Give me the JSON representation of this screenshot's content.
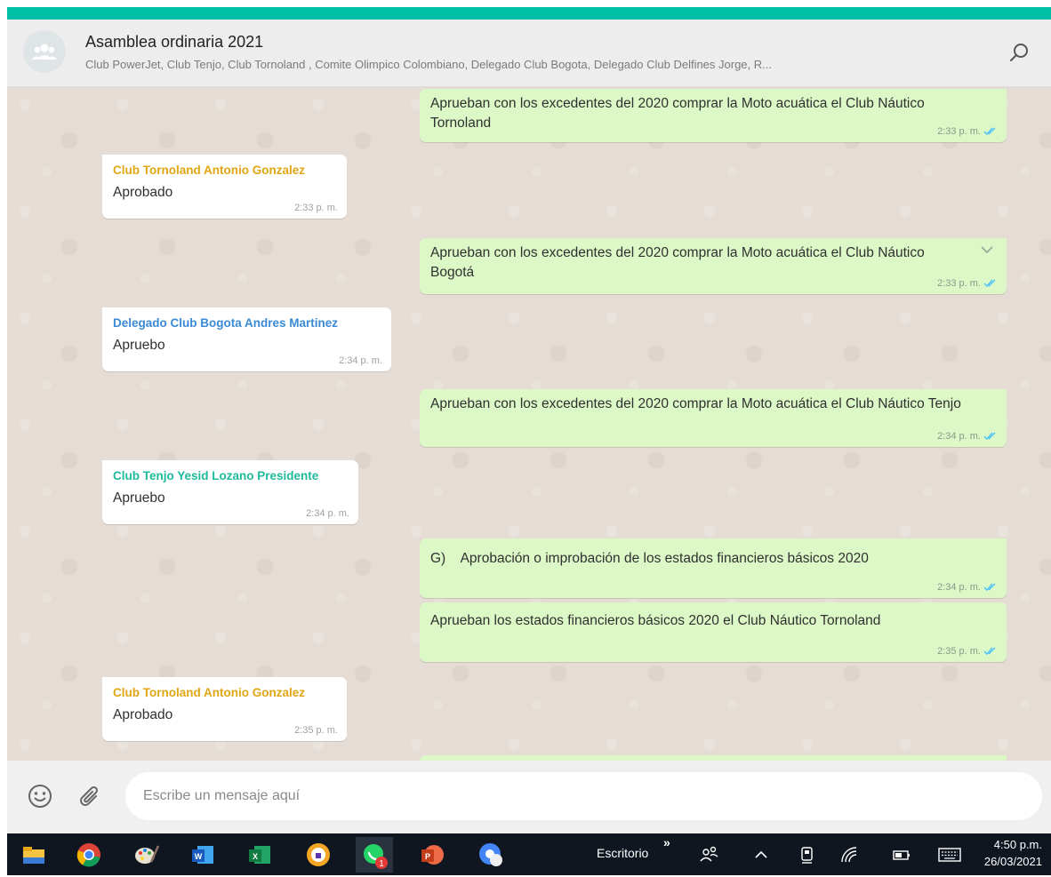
{
  "header": {
    "title": "Asamblea ordinaria 2021",
    "participants": "Club PowerJet, Club Tenjo, Club Tornoland , Comite Olimpico Colombiano, Delegado Club Bogota, Delegado Club Delfines Jorge, R..."
  },
  "messages": [
    {
      "type": "out",
      "text": "Aprueban con los excedentes del 2020 comprar la Moto acuática el Club Náutico Tornoland",
      "time": "2:33 p. m."
    },
    {
      "type": "in",
      "sender": "Club Tornoland Antonio Gonzalez",
      "text": "Aprobado",
      "time": "2:33 p. m."
    },
    {
      "type": "out",
      "text": "Aprueban con los excedentes del 2020 comprar la Moto acuática el Club Náutico Bogotá",
      "time": "2:33 p. m."
    },
    {
      "type": "in",
      "sender": "Delegado Club Bogota Andres Martinez",
      "text": "Apruebo",
      "time": "2:34 p. m."
    },
    {
      "type": "out",
      "text": "Aprueban con los excedentes del 2020 comprar la Moto acuática el Club Náutico Tenjo",
      "time": "2:34 p. m."
    },
    {
      "type": "in",
      "sender": "Club Tenjo Yesid Lozano Presidente",
      "text": "Apruebo",
      "time": "2:34 p. m."
    },
    {
      "type": "out",
      "text": "G)    Aprobación o improbación de los estados financieros básicos 2020",
      "time": "2:34 p. m."
    },
    {
      "type": "out",
      "text": "Aprueban los estados financieros básicos 2020 el Club Náutico Tornoland",
      "time": "2:35 p. m."
    },
    {
      "type": "in",
      "sender": "Club Tornoland Antonio Gonzalez",
      "text": "Aprobado",
      "time": "2:35 p. m."
    }
  ],
  "colors": {
    "sender_tornoland": "#e0a614",
    "sender_bogota": "#3a8ad6",
    "sender_tenjo": "#1fba9c",
    "accent": "#00bfa5",
    "read_ticks": "#4fc3f7"
  },
  "composer": {
    "placeholder": "Escribe un mensaje aquí"
  },
  "taskbar": {
    "toolbar_label": "Escritorio",
    "overflow_glyph": "»",
    "whatsapp_badge": "1",
    "time": "4:50 p.m.",
    "date": "26/03/2021",
    "apps": [
      "file-explorer",
      "chrome",
      "paint",
      "word",
      "excel",
      "vpn",
      "whatsapp",
      "powerpoint",
      "chrome-user"
    ]
  }
}
